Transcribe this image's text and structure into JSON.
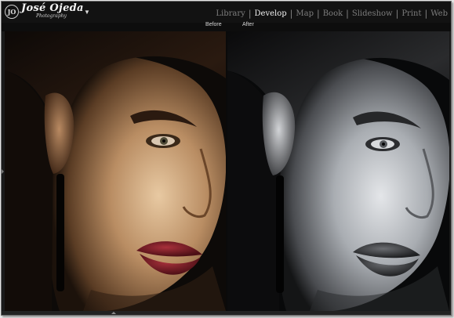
{
  "identity": {
    "logo_initials": "JO",
    "logo_name": "José Ojeda",
    "logo_subtitle": "Photography",
    "menu_icon": "triangle-down-icon"
  },
  "modules": [
    {
      "label": "Library",
      "active": false
    },
    {
      "label": "Develop",
      "active": true
    },
    {
      "label": "Map",
      "active": false
    },
    {
      "label": "Book",
      "active": false
    },
    {
      "label": "Slideshow",
      "active": false
    },
    {
      "label": "Print",
      "active": false
    },
    {
      "label": "Web",
      "active": false
    }
  ],
  "compare": {
    "before_label": "Before",
    "after_label": "After"
  },
  "colors": {
    "panel_bg": "#1a1a1a",
    "active_module": "#f0f0f0",
    "inactive_module": "#7d7d7d",
    "lip_before": "#8a1f28"
  }
}
